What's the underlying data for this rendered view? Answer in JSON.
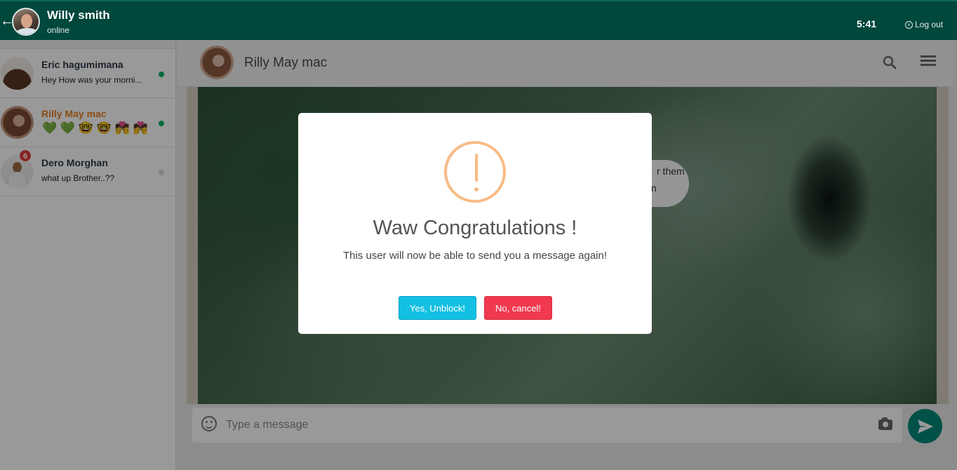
{
  "topbar": {
    "user_name": "Willy smith",
    "user_status": "online",
    "clock": "5:41",
    "logout_label": "Log out"
  },
  "contacts": [
    {
      "name": "Eric hagumimana",
      "message": "Hey How was your morni...",
      "online": true
    },
    {
      "name": "Rilly May mac",
      "message": "💚 💚 🤓 🤓 💏 💏",
      "online": true,
      "active": true
    },
    {
      "name": "Dero Morghan",
      "message": "what up Brother..??",
      "online": false,
      "unread": "6"
    }
  ],
  "chat": {
    "title": "Rilly May mac",
    "bubble_line1": "r them",
    "bubble_line2": "n",
    "input_placeholder": "Type a message"
  },
  "modal": {
    "title": "Waw Congratulations !",
    "text": "This user will now be able to send you a message again!",
    "confirm_label": "Yes, Unblock!",
    "cancel_label": "No, cancel!"
  },
  "colors": {
    "topbar": "#00473c",
    "warning": "#f8bb86",
    "confirm": "#13c0e3",
    "cancel": "#f0394f",
    "send": "#00897b"
  }
}
